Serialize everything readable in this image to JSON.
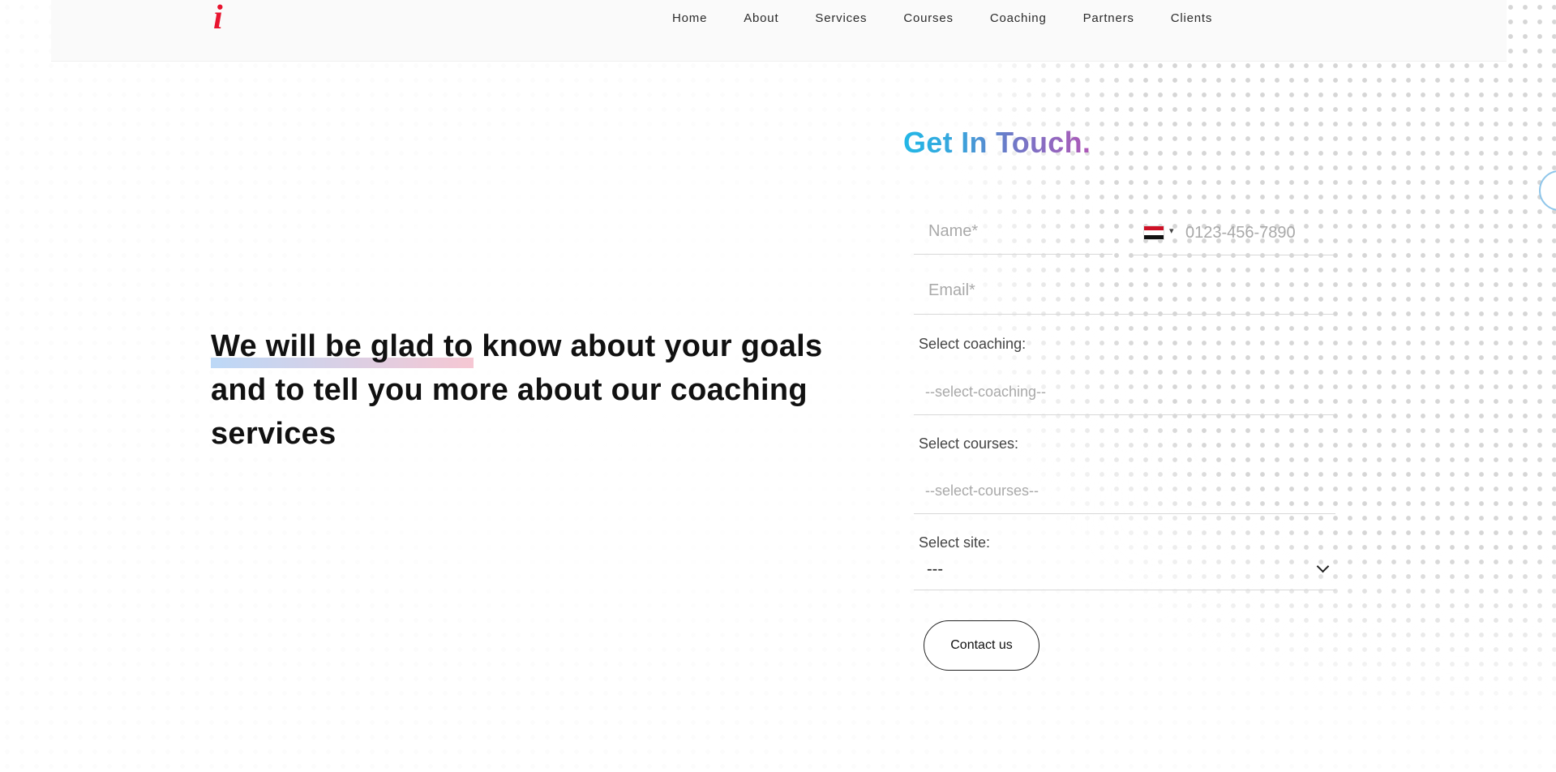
{
  "nav": {
    "logo": "i",
    "links": [
      "Home",
      "About",
      "Services",
      "Courses",
      "Coaching",
      "Partners",
      "Clients"
    ]
  },
  "hero": {
    "headline_line1": "We will be glad to know about your goals",
    "headline_line2": "and to tell you more about our coaching",
    "headline_line3": "services"
  },
  "form": {
    "title": "Get In Touch.",
    "name_placeholder": "Name*",
    "phone_placeholder": "0123-456-7890",
    "phone_country": "Egypt",
    "email_placeholder": "Email*",
    "coaching_label": "Select coaching:",
    "coaching_value": "--select-coaching--",
    "courses_label": "Select courses:",
    "courses_value": "--select-courses--",
    "site_label": "Select site:",
    "site_value": "---",
    "submit_label": "Contact us"
  },
  "colors": {
    "logo": "#e8142f",
    "title_gradient_start": "#22b7e6",
    "title_gradient_end": "#b058b8"
  }
}
